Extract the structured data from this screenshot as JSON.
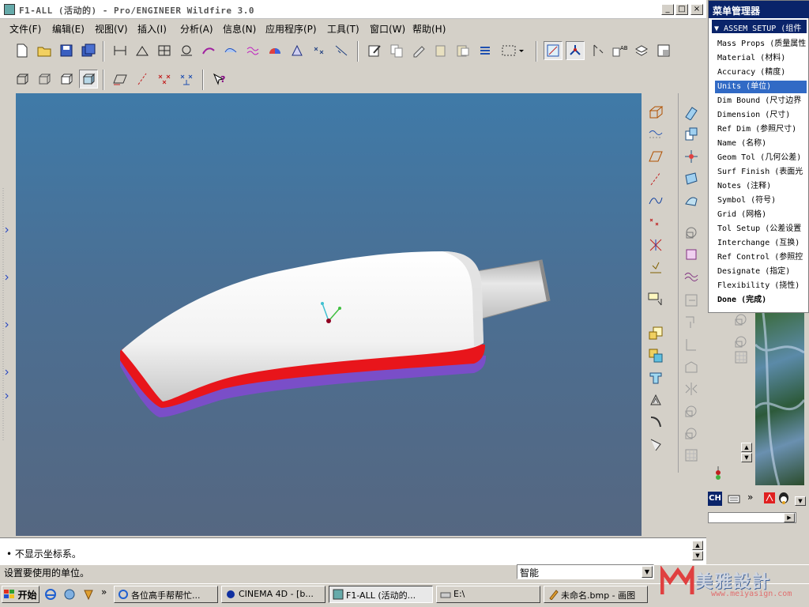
{
  "window": {
    "title": "F1-ALL (活动的) - Pro/ENGINEER Wildfire 3.0",
    "min_label": "_",
    "max_label": "□",
    "close_label": "×"
  },
  "menubar": {
    "items": [
      {
        "label": "文件(F)"
      },
      {
        "label": "编辑(E)"
      },
      {
        "label": "视图(V)"
      },
      {
        "label": "插入(I)"
      },
      {
        "label": "分析(A)"
      },
      {
        "label": "信息(N)"
      },
      {
        "label": "应用程序(P)"
      },
      {
        "label": "工具(T)"
      },
      {
        "label": "窗口(W)"
      },
      {
        "label": "帮助(H)"
      }
    ]
  },
  "menu_manager": {
    "title": "菜单管理器",
    "header": "ASSEM SETUP (组件",
    "items": [
      {
        "label": "Mass Props (质量属性"
      },
      {
        "label": "Material (材料)"
      },
      {
        "label": "Accuracy (精度)"
      },
      {
        "label": "Units (单位)"
      },
      {
        "label": "Dim Bound (尺寸边界"
      },
      {
        "label": "Dimension (尺寸)"
      },
      {
        "label": "Ref Dim (参照尺寸)"
      },
      {
        "label": "Name (名称)"
      },
      {
        "label": "Geom Tol (几何公差)"
      },
      {
        "label": "Surf Finish (表面光"
      },
      {
        "label": "Notes (注释)"
      },
      {
        "label": "Symbol (符号)"
      },
      {
        "label": "Grid (网格)"
      },
      {
        "label": "Tol Setup (公差设置"
      },
      {
        "label": "Interchange (互换)"
      },
      {
        "label": "Ref Control (参照控"
      },
      {
        "label": "Designate (指定)"
      },
      {
        "label": "Flexibility (挠性)"
      },
      {
        "label": "Done (完成)"
      }
    ],
    "selected_index": 3
  },
  "messages": {
    "last_message": "• 不显示坐标系。",
    "status": "设置要使用的单位。",
    "filter_value": "智能"
  },
  "taskbar": {
    "start_label": "开始",
    "overflow": "»",
    "tasks": [
      {
        "label": "各位高手帮帮忙..."
      },
      {
        "label": "CINEMA 4D - [b..."
      },
      {
        "label": "F1-ALL (活动的..."
      },
      {
        "label": "E:\\"
      },
      {
        "label": "未命名.bmp - 画图"
      }
    ],
    "active_index": 2,
    "ch_label": "CH"
  },
  "watermark": {
    "text": "美雅設計",
    "url": "www.meiyasign.com"
  },
  "colors": {
    "menu_selected": "#316ac5",
    "title_blue": "#0a246a",
    "viewport_top": "#3f7aa8",
    "viewport_bottom": "#556781",
    "part_red": "#e8151b",
    "part_purple": "#7a4ec8",
    "part_white": "#f4f4f4"
  },
  "icons": {
    "toolbar1": [
      "new-file-icon",
      "open-folder-icon",
      "save-icon",
      "save-copy-icon",
      "spin-center-icon",
      "datum-plane-icon",
      "regenerate-icon",
      "model-tree-icon",
      "measure-icon",
      "curve-analysis-icon",
      "sweep-icon",
      "shade-icon",
      "surface-icon",
      "datum-point-icon",
      "datum-axis-icon",
      "edit-sketch-icon",
      "copy-icon",
      "paste-icon",
      "paste-special-icon",
      "mirror-icon",
      "selection-box-icon",
      "repaint-icon",
      "spin-axis-icon",
      "insert-point-icon",
      "annotation-icon",
      "layers-icon",
      "view-manager-icon"
    ],
    "toolbar2": [
      "wireframe-icon",
      "hidden-line-icon",
      "no-hidden-icon",
      "shading-icon",
      "plane-display-icon",
      "axis-display-icon",
      "point-display-icon",
      "csys-display-icon",
      "context-help-icon"
    ]
  }
}
